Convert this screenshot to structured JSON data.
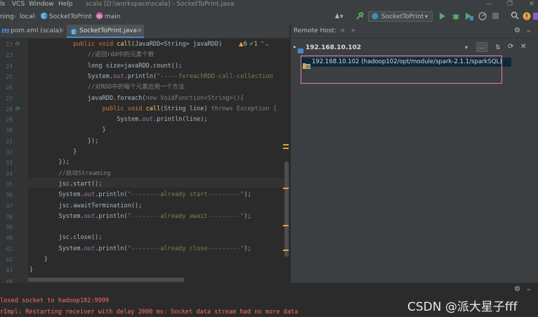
{
  "menubar": {
    "items": [
      "ls",
      "VCS",
      "Window",
      "Help"
    ],
    "title": "scala [D:\\workspace\\scala] - SocketToPrint.java"
  },
  "navbar": {
    "crumbs": [
      "ning",
      "local",
      "SocketToPrint",
      "main"
    ],
    "run_config": "SocketToPrint"
  },
  "editor_tabs": [
    {
      "label": "pom.xml (scala)",
      "close": "×"
    },
    {
      "label": "SocketToPrint.java",
      "close": "×"
    }
  ],
  "inspection": {
    "warnings": "6",
    "ok": "1"
  },
  "line_numbers": [
    "22",
    "23",
    "24",
    "25",
    "26",
    "27",
    "28",
    "29",
    "30",
    "31",
    "32",
    "33",
    "34",
    "35",
    "36",
    "37",
    "38",
    "39",
    "40",
    "41",
    "42",
    "43",
    "44"
  ],
  "code": [
    [
      "            ",
      "public void ",
      "call",
      "(JavaRDD<String> javaRDD)"
    ],
    [
      "                ",
      "//返回rdd中的元素个数"
    ],
    [
      "                ",
      "long size=javaRDD.count();"
    ],
    [
      "                ",
      "System.",
      "out",
      ".println(",
      "\"-----foreachRDD-call-collection"
    ],
    [
      "                ",
      "//对RDD中的每个元素应用一个方法"
    ],
    [
      "                ",
      "javaRDD.foreach(",
      "new VoidFunction<String>(){"
    ],
    [
      "                    ",
      "public void ",
      "call",
      "(String line) ",
      "throws Exception {"
    ],
    [
      "                        ",
      "System.",
      "out",
      ".println(line);"
    ],
    [
      "                    ",
      "}"
    ],
    [
      "                ",
      "});"
    ],
    [
      "            ",
      "}"
    ],
    [
      "        ",
      "});"
    ],
    [
      "        ",
      "//启动Streaming"
    ],
    [
      "        ",
      "jsc.start();"
    ],
    [
      "        ",
      "System.",
      "out",
      ".println(",
      "\"--------already start---------\"",
      ");"
    ],
    [
      "        ",
      "jsc.awaitTermination();"
    ],
    [
      "        ",
      "System.",
      "out",
      ".println(",
      "\"--------already await---------\"",
      ");"
    ],
    [
      "",
      ""
    ],
    [
      "        ",
      "jsc.close();"
    ],
    [
      "        ",
      "System.",
      "out",
      ".println(",
      "\"--------already close---------\"",
      ");"
    ],
    [
      "    ",
      "}"
    ],
    [
      "",
      "}"
    ],
    [
      "",
      ""
    ]
  ],
  "remote": {
    "tab_label": "Remote Host:",
    "tab_close": "×",
    "host": "192.168.10.102",
    "browse_label": "...",
    "entry": "192.168.10.102 (hadoop102/opt/module/spark-2.1.1/sparkSQL)"
  },
  "console": {
    "line1": "losed socket to hadoop102:9999",
    "line2": "rImpl: Restarting receiver with delay 2000 ms: Socket data stream had no more data"
  },
  "watermark": "CSDN @派大星子fff",
  "colors": {
    "editor_bg": "#2b2b2b",
    "panel_bg": "#3c3f41",
    "keyword": "#cc7832",
    "string": "#6a8759",
    "comment": "#808080",
    "field": "#9876aa",
    "method": "#ffc66d",
    "selection": "#0d293e",
    "highlight_border": "#e080b0",
    "console_error": "#ff6b68"
  }
}
